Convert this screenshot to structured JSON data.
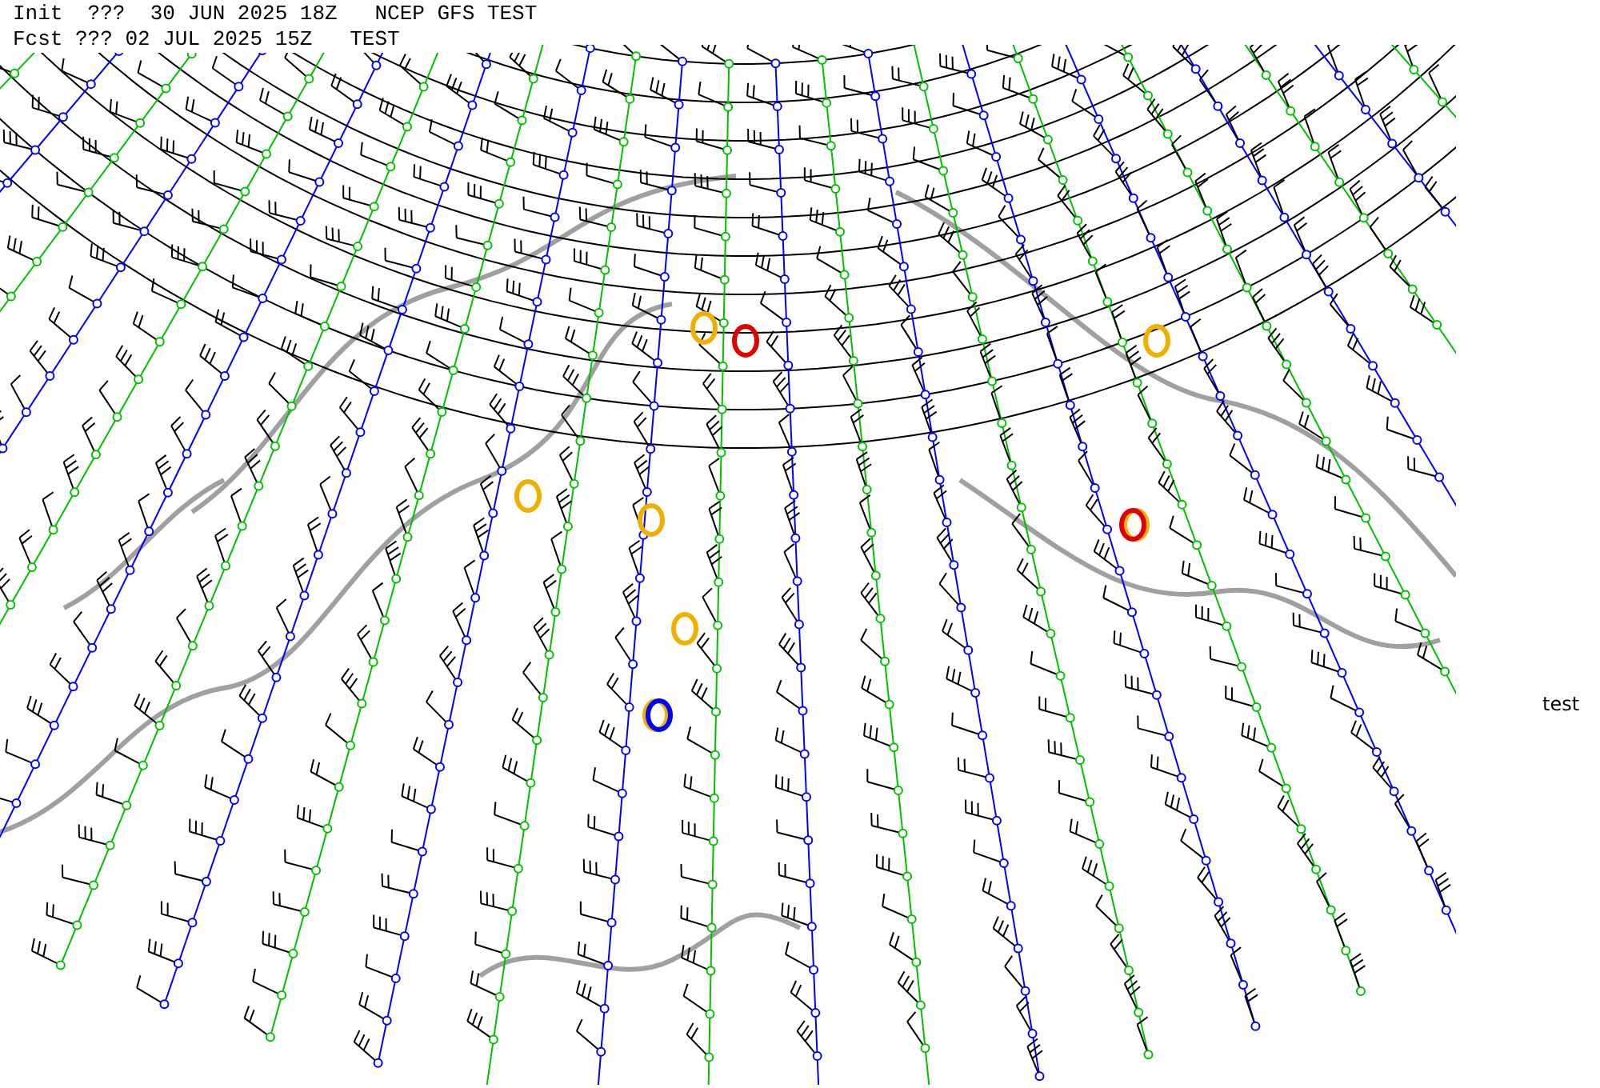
{
  "header": {
    "line_1": "Init  ???  30 JUN 2025 18Z   NCEP GFS TEST",
    "line_2": "Fcst ??? 02 JUL 2025 15Z   TEST"
  },
  "side_label": "test"
}
